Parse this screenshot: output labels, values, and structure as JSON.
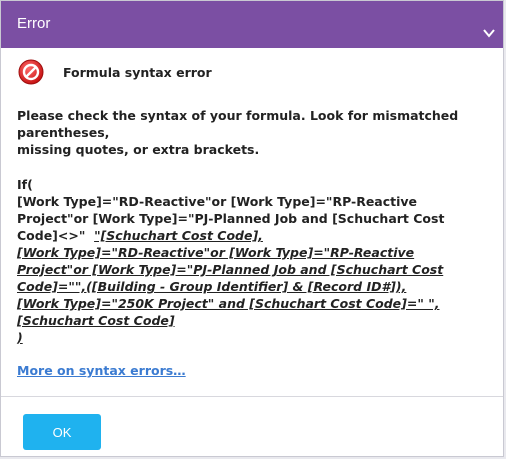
{
  "window": {
    "title": "Error",
    "close_icon": "chevron-down-icon"
  },
  "colors": {
    "titlebar": "#7b4fa3",
    "ok_button": "#1fb2ef",
    "link": "#3b7bd1",
    "error_icon": "#e02424"
  },
  "heading": {
    "icon": "error-stop-icon",
    "text": "Formula syntax error"
  },
  "message": {
    "line1": "Please check the syntax of your formula. Look for mismatched parentheses,",
    "line2": "missing quotes, or extra brackets."
  },
  "formula": {
    "l1": "If(",
    "l2": "[Work Type]=\"RD-Reactive\"or [Work Type]=\"RP-Reactive",
    "l3": "Project\"or [Work Type]=\"PJ-Planned Job and [Schuchart Cost",
    "l4a": "Code]<>\"  ",
    "l4b": "\"[Schuchart Cost Code],",
    "l5": "[Work Type]=\"RD-Reactive\"or [Work Type]=\"RP-Reactive",
    "l6": "Project\"or [Work Type]=\"PJ-Planned Job and [Schuchart Cost",
    "l7": "Code]=\"\",([Building - Group Identifier] & [Record ID#]),",
    "l8": "[Work Type]=\"250K Project\" and [Schuchart Cost Code]=\" \",",
    "l9": "[Schuchart Cost Code]",
    "l10": ")"
  },
  "link": {
    "label": "More on syntax errors…"
  },
  "footer": {
    "ok_label": "OK"
  }
}
